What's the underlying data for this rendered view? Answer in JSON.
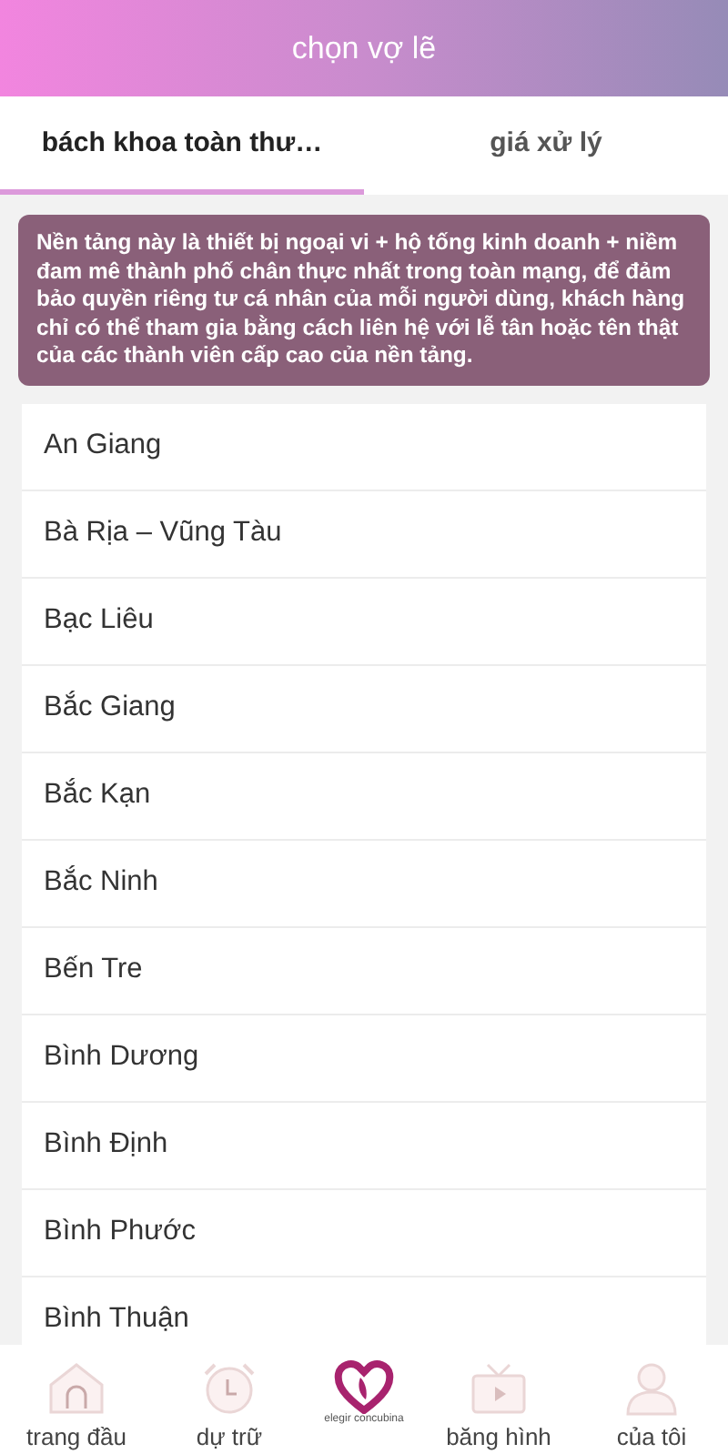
{
  "header": {
    "title": "chọn vợ lẽ"
  },
  "tabs": [
    {
      "label": "bách khoa toàn thư…",
      "selected": true
    },
    {
      "label": "giá xử lý",
      "selected": false
    }
  ],
  "notice": "Nền tảng này là thiết bị ngoại vi + hộ tống kinh doanh + niềm đam mê thành phố chân thực nhất trong toàn mạng, để đảm bảo quyền riêng tư cá nhân của mỗi người dùng, khách hàng chỉ có thể tham gia bằng cách liên hệ với lễ tân hoặc tên thật của các thành viên cấp cao của nền tảng.",
  "provinces": [
    "An Giang",
    "Bà Rịa – Vũng Tàu",
    "Bạc Liêu",
    "Bắc Giang",
    "Bắc Kạn",
    "Bắc Ninh",
    "Bến Tre",
    "Bình Dương",
    "Bình Định",
    "Bình Phước",
    "Bình Thuận"
  ],
  "nav": [
    {
      "kind": "home",
      "label": "trang đầu"
    },
    {
      "kind": "clock",
      "label": "dự trữ"
    },
    {
      "kind": "logo",
      "label": "elegir concubina"
    },
    {
      "kind": "tv",
      "label": "băng hình"
    },
    {
      "kind": "user",
      "label": "của tôi"
    }
  ]
}
